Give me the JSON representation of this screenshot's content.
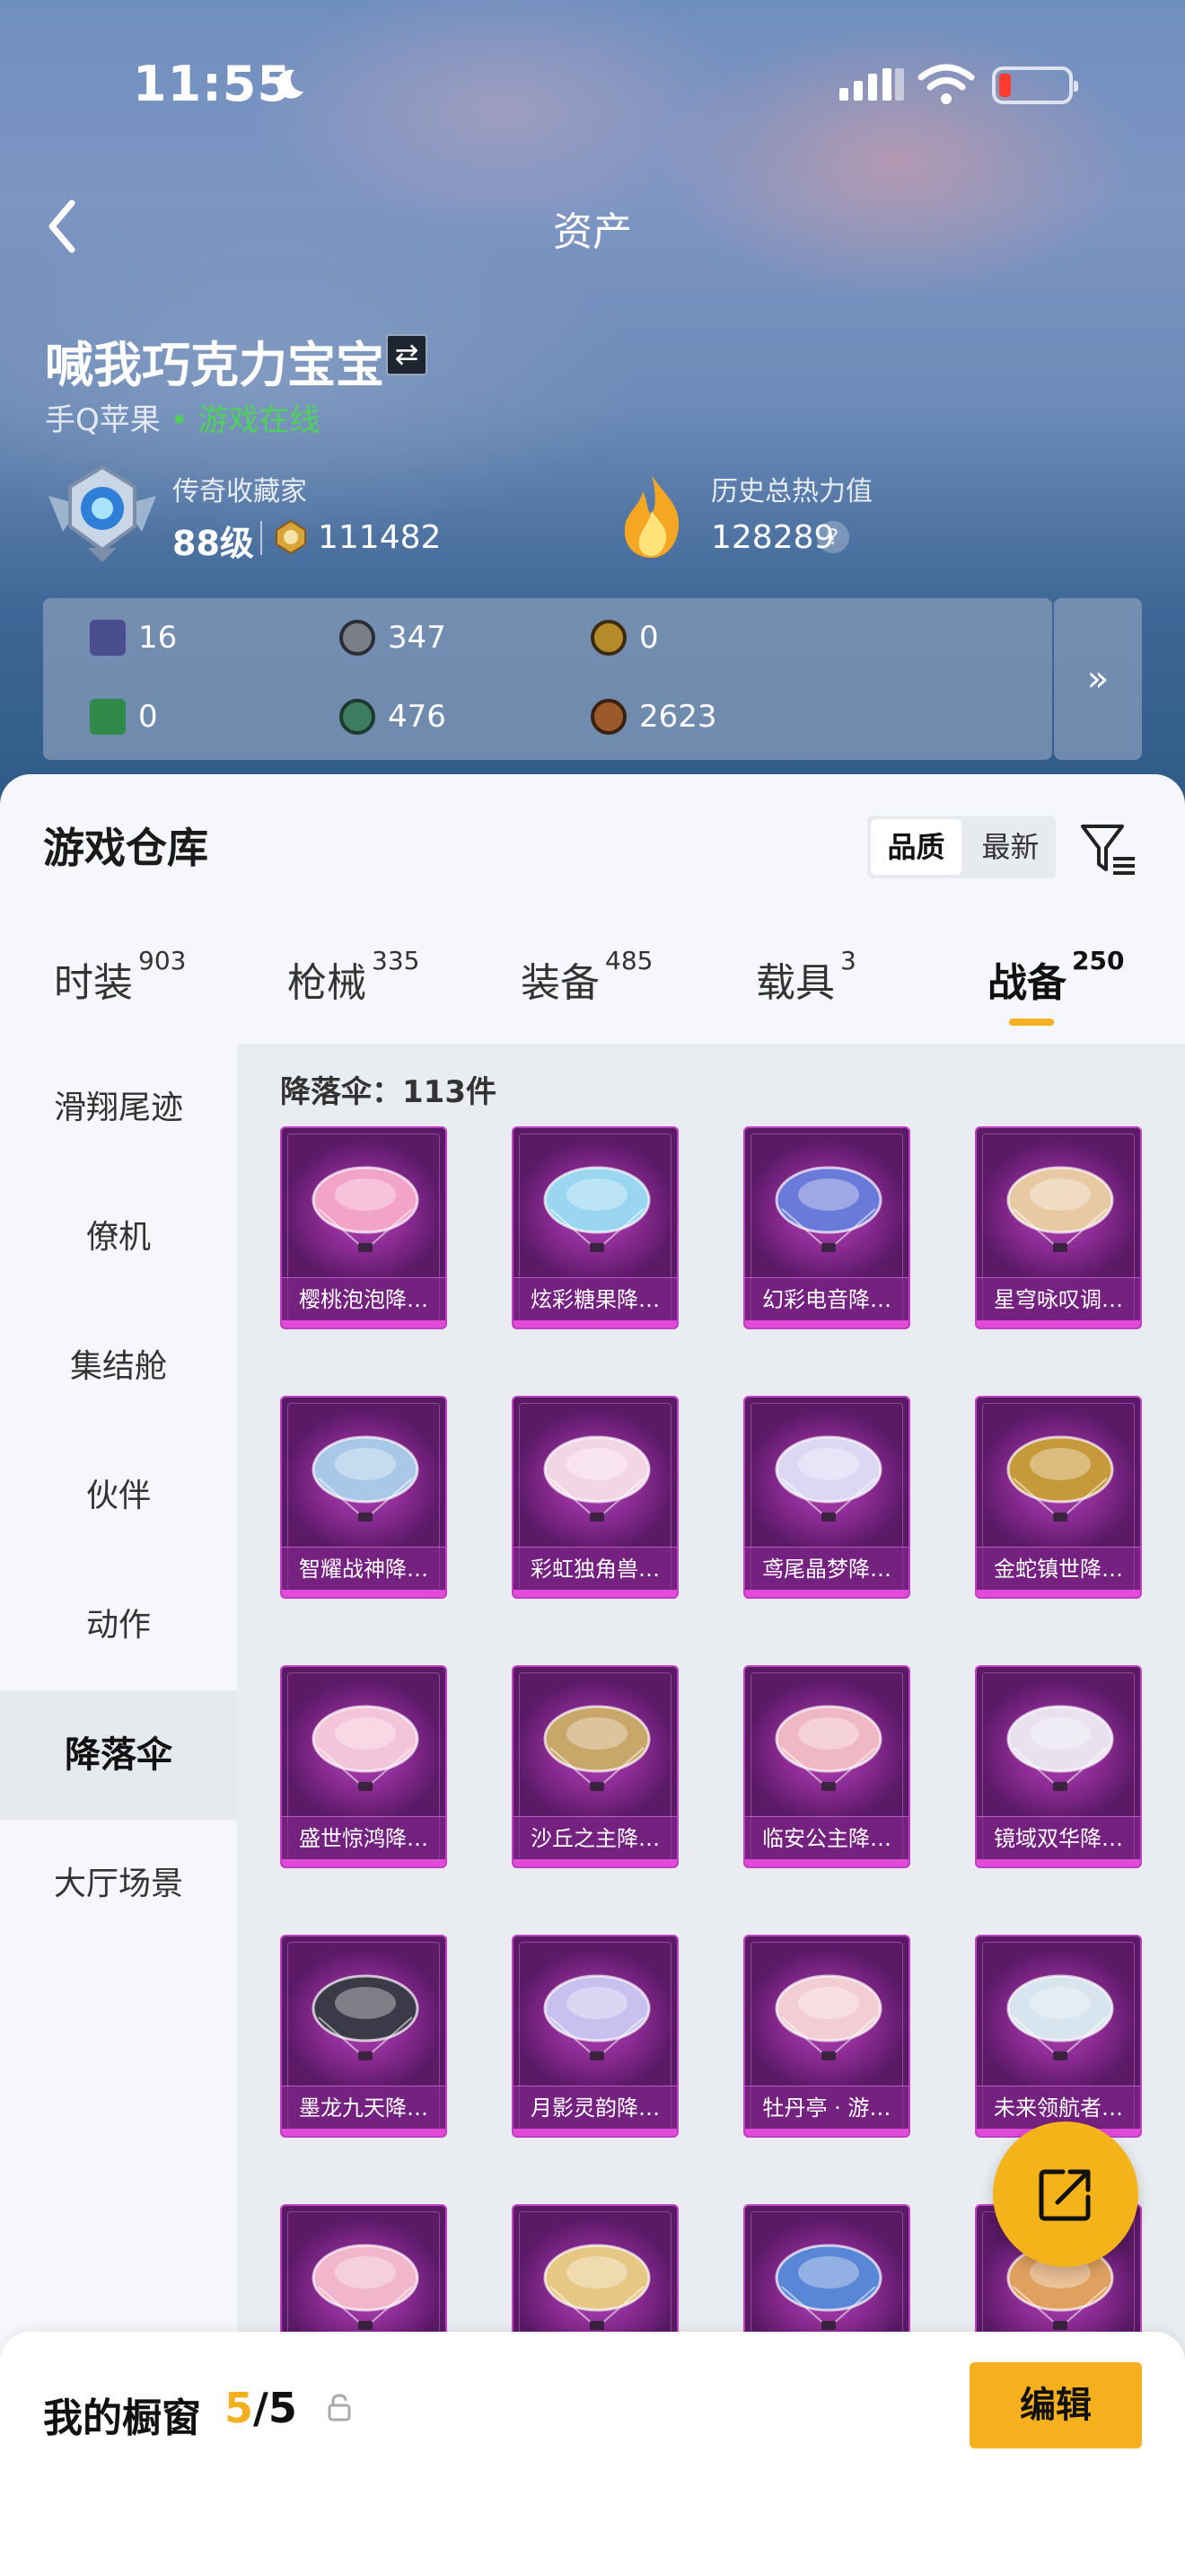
{
  "status": {
    "time": "11:55"
  },
  "nav": {
    "title": "资产"
  },
  "profile": {
    "username": "喊我巧克力宝宝",
    "switch_glyph": "⇄",
    "platform": "手Q苹果",
    "online_status": "• 游戏在线",
    "rank_title": "传奇收藏家",
    "level": "88级",
    "points": "111482",
    "heat_title": "历史总热力值",
    "heat_value": "128289",
    "help_glyph": "?"
  },
  "currencies": [
    {
      "icon": "card-icon",
      "value": "16",
      "color": "#4b4e8c"
    },
    {
      "icon": "silver-coin-icon",
      "value": "347",
      "color": "#7a7f87"
    },
    {
      "icon": "gold-token-icon",
      "value": "0",
      "color": "#b58a2a"
    },
    {
      "icon": "green-card-icon",
      "value": "0",
      "color": "#2f8a4a"
    },
    {
      "icon": "jade-coin-icon",
      "value": "476",
      "color": "#3c7c60"
    },
    {
      "icon": "bronze-coin-icon",
      "value": "2623",
      "color": "#9a5a2c"
    }
  ],
  "currency_more": "»",
  "warehouse": {
    "title": "游戏仓库",
    "sort_options": [
      "品质",
      "最新"
    ],
    "tabs": [
      {
        "label": "时装",
        "count": "903"
      },
      {
        "label": "枪械",
        "count": "335"
      },
      {
        "label": "装备",
        "count": "485"
      },
      {
        "label": "载具",
        "count": "3"
      },
      {
        "label": "战备",
        "count": "250"
      }
    ],
    "sidebar": [
      "滑翔尾迹",
      "僚机",
      "集结舱",
      "伙伴",
      "动作",
      "降落伞",
      "大厅场景"
    ],
    "count_label": "降落伞：113件",
    "items": [
      {
        "name": "樱桃泡泡降…",
        "color": "#f2a4c8"
      },
      {
        "name": "炫彩糖果降…",
        "color": "#9ad6f0"
      },
      {
        "name": "幻彩电音降…",
        "color": "#6a7ad8"
      },
      {
        "name": "星穹咏叹调…",
        "color": "#e8c9a4"
      },
      {
        "name": "智耀战神降…",
        "color": "#a9c8e8"
      },
      {
        "name": "彩虹独角兽…",
        "color": "#f3d6e6"
      },
      {
        "name": "鸢尾晶梦降…",
        "color": "#dcd8f4"
      },
      {
        "name": "金蛇镇世降…",
        "color": "#c6993a"
      },
      {
        "name": "盛世惊鸿降…",
        "color": "#f4c4d8"
      },
      {
        "name": "沙丘之主降…",
        "color": "#c9a66a"
      },
      {
        "name": "临安公主降…",
        "color": "#f0b8c4"
      },
      {
        "name": "镜域双华降…",
        "color": "#e8e2f0"
      },
      {
        "name": "墨龙九天降…",
        "color": "#3a3a48"
      },
      {
        "name": "月影灵韵降…",
        "color": "#c8c0ee"
      },
      {
        "name": "牡丹亭 · 游…",
        "color": "#f2cdd4"
      },
      {
        "name": "未来领航者…",
        "color": "#d8e4ee"
      },
      {
        "name": "",
        "color": "#f2b6cc"
      },
      {
        "name": "",
        "color": "#e6c884"
      },
      {
        "name": "",
        "color": "#5a86d8"
      },
      {
        "name": "",
        "color": "#e0a060"
      }
    ]
  },
  "showcase": {
    "title": "我的橱窗",
    "current": "5",
    "total": "/5",
    "edit_label": "编辑"
  },
  "colors": {
    "accent": "#f4b021",
    "online": "#4fd15b",
    "card": "#8a2a92"
  }
}
